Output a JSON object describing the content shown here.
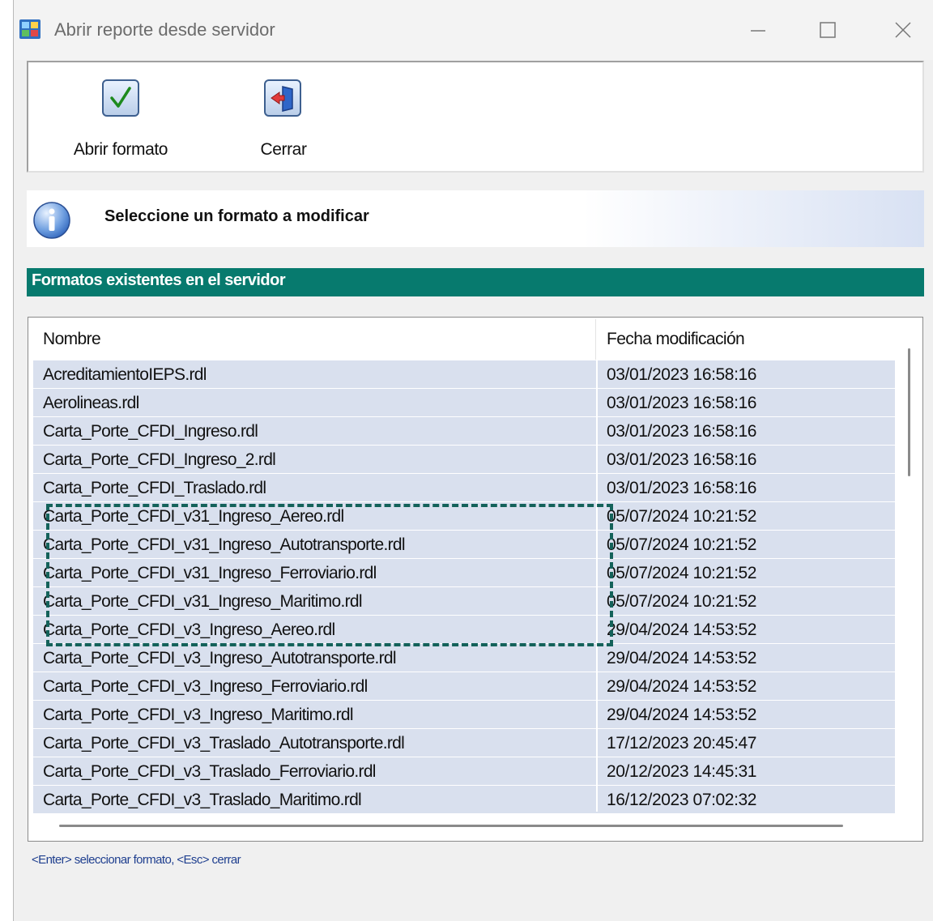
{
  "window": {
    "title": "Abrir reporte desde servidor"
  },
  "toolbar": {
    "open_label": "Abrir formato",
    "close_label": "Cerrar"
  },
  "info": {
    "message": "Seleccione un formato a modificar"
  },
  "section": {
    "title": "Formatos existentes en el servidor"
  },
  "list": {
    "columns": [
      "Nombre",
      "Fecha modificación"
    ],
    "rows": [
      {
        "name": "AcreditamientoIEPS.rdl",
        "date": "03/01/2023 16:58:16"
      },
      {
        "name": "Aerolineas.rdl",
        "date": "03/01/2023 16:58:16"
      },
      {
        "name": "Carta_Porte_CFDI_Ingreso.rdl",
        "date": "03/01/2023 16:58:16"
      },
      {
        "name": "Carta_Porte_CFDI_Ingreso_2.rdl",
        "date": "03/01/2023 16:58:16"
      },
      {
        "name": "Carta_Porte_CFDI_Traslado.rdl",
        "date": "03/01/2023 16:58:16"
      },
      {
        "name": "Carta_Porte_CFDI_v31_Ingreso_Aereo.rdl",
        "date": "05/07/2024 10:21:52"
      },
      {
        "name": "Carta_Porte_CFDI_v31_Ingreso_Autotransporte.rdl",
        "date": "05/07/2024 10:21:52"
      },
      {
        "name": "Carta_Porte_CFDI_v31_Ingreso_Ferroviario.rdl",
        "date": "05/07/2024 10:21:52"
      },
      {
        "name": "Carta_Porte_CFDI_v31_Ingreso_Maritimo.rdl",
        "date": "05/07/2024 10:21:52"
      },
      {
        "name": "Carta_Porte_CFDI_v3_Ingreso_Aereo.rdl",
        "date": "29/04/2024 14:53:52"
      },
      {
        "name": "Carta_Porte_CFDI_v3_Ingreso_Autotransporte.rdl",
        "date": "29/04/2024 14:53:52"
      },
      {
        "name": "Carta_Porte_CFDI_v3_Ingreso_Ferroviario.rdl",
        "date": "29/04/2024 14:53:52"
      },
      {
        "name": "Carta_Porte_CFDI_v3_Ingreso_Maritimo.rdl",
        "date": "29/04/2024 14:53:52"
      },
      {
        "name": "Carta_Porte_CFDI_v3_Traslado_Autotransporte.rdl",
        "date": "17/12/2023 20:45:47"
      },
      {
        "name": "Carta_Porte_CFDI_v3_Traslado_Ferroviario.rdl",
        "date": "20/12/2023 14:45:31"
      },
      {
        "name": "Carta_Porte_CFDI_v3_Traslado_Maritimo.rdl",
        "date": "16/12/2023 07:02:32"
      }
    ]
  },
  "footer": {
    "hint": "<Enter> seleccionar formato, <Esc> cerrar"
  },
  "colors": {
    "section_header": "#077a6e",
    "row_background": "#d9e0ee",
    "highlight_border": "#14625a",
    "hint_text": "#1f3f8f"
  },
  "icons": {
    "app": "app-icon",
    "open": "checkmark-icon",
    "close": "exit-door-icon",
    "info": "info-icon"
  }
}
